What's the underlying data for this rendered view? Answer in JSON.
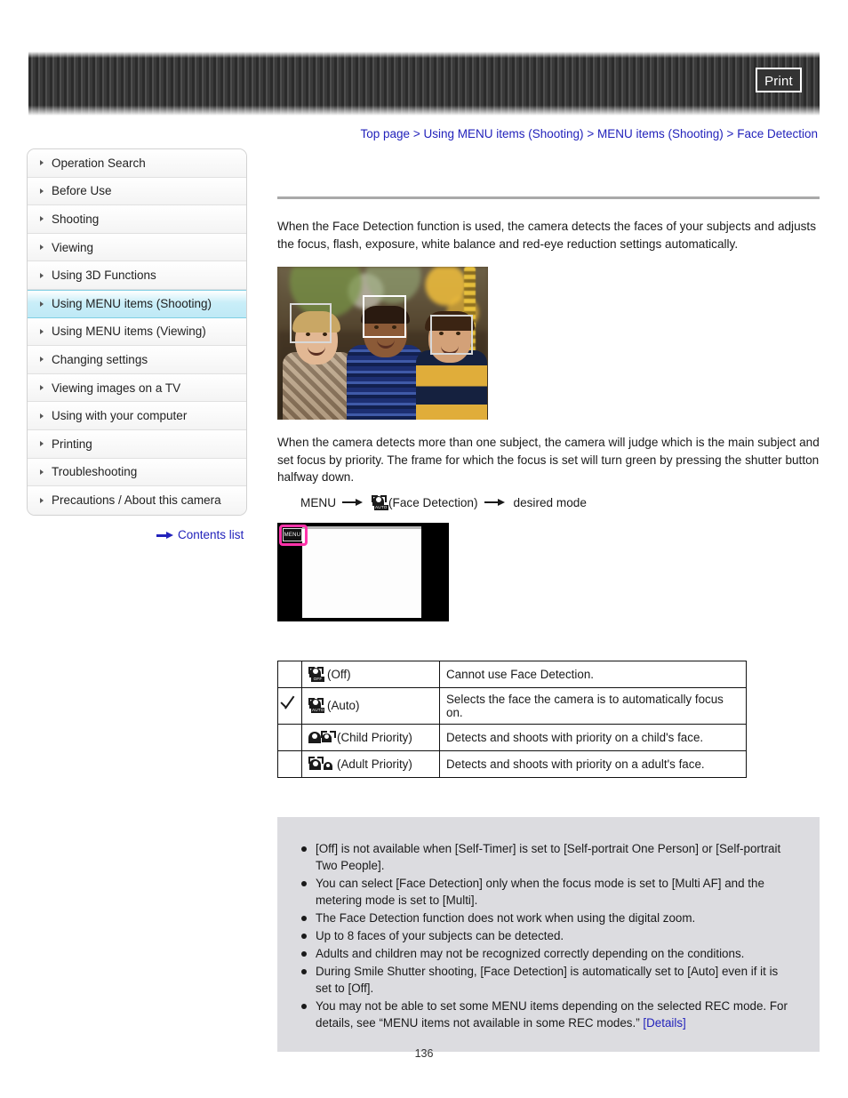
{
  "header": {
    "print_label": "Print",
    "print_icon": "printer-icon"
  },
  "breadcrumb": {
    "items": [
      {
        "label": "Top page"
      },
      {
        "label": "Using MENU items (Shooting)"
      },
      {
        "label": "MENU items (Shooting)"
      },
      {
        "label": "Face Detection"
      }
    ],
    "separator": ">"
  },
  "sidebar": {
    "items": [
      {
        "label": "Operation Search",
        "active": false
      },
      {
        "label": "Before Use",
        "active": false
      },
      {
        "label": "Shooting",
        "active": false
      },
      {
        "label": "Viewing",
        "active": false
      },
      {
        "label": "Using 3D Functions",
        "active": false
      },
      {
        "label": "Using MENU items (Shooting)",
        "active": true
      },
      {
        "label": "Using MENU items (Viewing)",
        "active": false
      },
      {
        "label": "Changing settings",
        "active": false
      },
      {
        "label": "Viewing images on a TV",
        "active": false
      },
      {
        "label": "Using with your computer",
        "active": false
      },
      {
        "label": "Printing",
        "active": false
      },
      {
        "label": "Troubleshooting",
        "active": false
      },
      {
        "label": "Precautions / About this camera",
        "active": false
      }
    ],
    "contents_link": "Contents list",
    "contents_icon": "right-arrow-icon"
  },
  "main": {
    "intro_paragraph": "When the Face Detection function is used, the camera detects the faces of your subjects and adjusts the focus, flash, exposure, white balance and red-eye reduction settings automatically.",
    "photo": {
      "alt": "Three smiling boys with face detection frames drawn around their faces",
      "frames": 3
    },
    "second_paragraph": "When the camera detects more than one subject, the camera will judge which is the main subject and set focus by priority. The frame for which the focus is set will turn green by pressing the shutter button halfway down.",
    "menu_path": {
      "start": "MENU",
      "icon_name": "face-detection-icon",
      "middle": "(Face Detection)",
      "end": "desired mode"
    },
    "lcd": {
      "menu_button_label": "MENU",
      "highlight_color": "#ff33aa"
    }
  },
  "options_table": {
    "rows": [
      {
        "checked": false,
        "icon": "face-detection-off-icon",
        "icon_tag": "OFF",
        "label": "(Off)",
        "description": "Cannot use Face Detection."
      },
      {
        "checked": true,
        "icon": "face-detection-auto-icon",
        "icon_tag": "AUTO",
        "label": "(Auto)",
        "description": "Selects the face the camera is to automatically focus on."
      },
      {
        "checked": false,
        "icon": "face-detection-child-priority-icon",
        "icon_tag": "",
        "label": "(Child Priority)",
        "description": "Detects and shoots with priority on a child's face."
      },
      {
        "checked": false,
        "icon": "face-detection-adult-priority-icon",
        "icon_tag": "",
        "label": "(Adult Priority)",
        "description": "Detects and shoots with priority on a adult's face."
      }
    ]
  },
  "notes": {
    "items": [
      {
        "text": "[Off] is not available when [Self-Timer] is set to [Self-portrait One Person] or [Self-portrait Two People]."
      },
      {
        "text": "You can select [Face Detection] only when the focus mode is set to [Multi AF] and the metering mode is set to [Multi]."
      },
      {
        "text": "The Face Detection function does not work when using the digital zoom."
      },
      {
        "text": "Up to 8 faces of your subjects can be detected."
      },
      {
        "text": "Adults and children may not be recognized correctly depending on the conditions."
      },
      {
        "text": "During Smile Shutter shooting, [Face Detection] is automatically set to [Auto] even if it is set to [Off]."
      },
      {
        "text": "You may not be able to set some MENU items depending on the selected REC mode. For details, see “MENU items not available in some REC modes.” ",
        "link": "[Details]"
      }
    ]
  },
  "footer": {
    "page_number": "136"
  },
  "colors": {
    "link": "#2222bb",
    "active_nav": "#bfe9f6",
    "notes_bg": "#dcdce0",
    "highlight_pink": "#ff33aa"
  }
}
